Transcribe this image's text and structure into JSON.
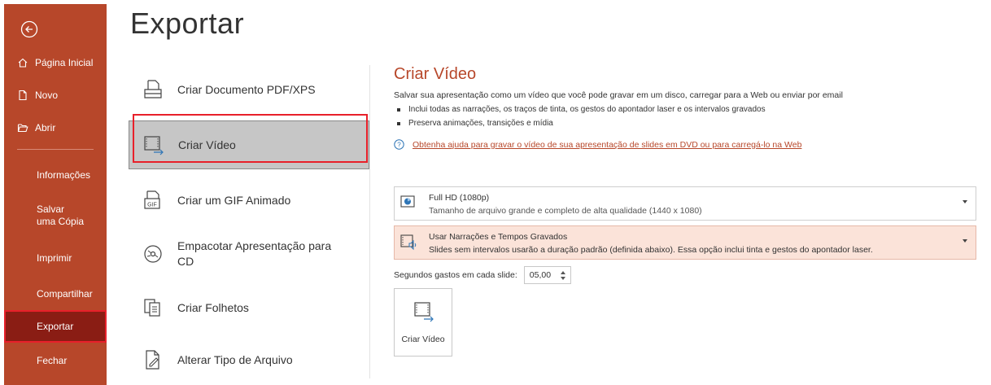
{
  "sidebar": {
    "back_icon": "back-arrow-icon",
    "top_items": [
      {
        "label": "Página Inicial",
        "icon": "home-icon"
      },
      {
        "label": "Novo",
        "icon": "new-file-icon"
      },
      {
        "label": "Abrir",
        "icon": "folder-open-icon"
      }
    ],
    "bottom_items": [
      {
        "label": "Informações"
      },
      {
        "label": "Salvar uma Cópia"
      },
      {
        "label": "Imprimir"
      },
      {
        "label": "Compartilhar"
      },
      {
        "label": "Exportar",
        "active": true
      },
      {
        "label": "Fechar"
      }
    ],
    "colors": {
      "background": "#b7472a",
      "active": "#8a1d14",
      "highlight": "#e8202a"
    }
  },
  "page": {
    "title": "Exportar"
  },
  "options": [
    {
      "label": "Criar Documento PDF/XPS",
      "icon": "pdf-document-icon"
    },
    {
      "label": "Criar Vídeo",
      "icon": "video-icon",
      "selected": true
    },
    {
      "label": "Criar um GIF Animado",
      "icon": "gif-icon"
    },
    {
      "label": "Empacotar Apresentação para CD",
      "icon": "cd-icon"
    },
    {
      "label": "Criar Folhetos",
      "icon": "handouts-icon"
    },
    {
      "label": "Alterar Tipo de Arquivo",
      "icon": "change-file-type-icon"
    }
  ],
  "panel": {
    "title": "Criar Vídeo",
    "description": "Salvar sua apresentação como um vídeo que você pode gravar em um disco, carregar para a Web ou enviar por email",
    "bullets": [
      "Inclui todas as narrações, os traços de tinta, os gestos do apontador laser e os intervalos gravados",
      "Preserva animações, transições e mídia"
    ],
    "help_link": "Obtenha ajuda para gravar o vídeo de sua apresentação de slides em DVD ou para carregá-lo na Web",
    "quality": {
      "main": "Full HD (1080p)",
      "sub": "Tamanho de arquivo grande e completo de alta qualidade (1440 x 1080)"
    },
    "narration": {
      "main": "Usar Narrações e Tempos Gravados",
      "sub": "Slides sem intervalos usarão a duração padrão (definida abaixo). Essa opção inclui tinta e gestos do apontador laser."
    },
    "seconds_label": "Segundos gastos em cada slide:",
    "seconds_value": "05,00",
    "create_button": "Criar Vídeo",
    "accent": "#b7472a"
  }
}
